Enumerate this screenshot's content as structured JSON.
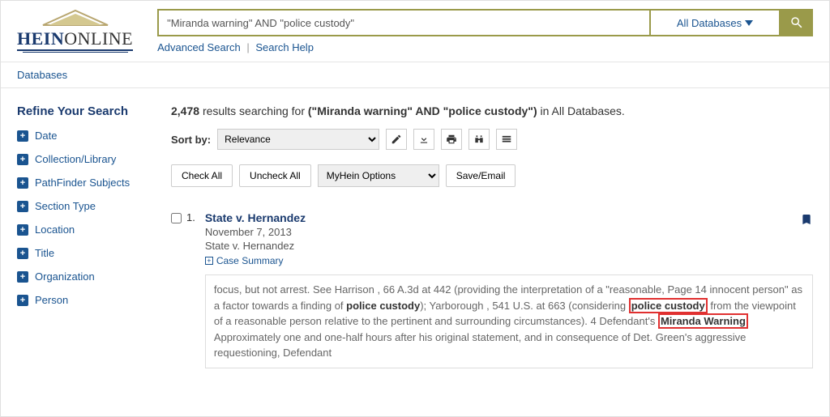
{
  "logo": {
    "brand1": "HEIN",
    "brand2": "ONLINE"
  },
  "search": {
    "query": "\"Miranda warning\" AND \"police custody\"",
    "db_button": "All Databases",
    "advanced": "Advanced Search",
    "help": "Search Help"
  },
  "nav": {
    "databases": "Databases"
  },
  "sidebar": {
    "title": "Refine Your Search",
    "facets": [
      "Date",
      "Collection/Library",
      "PathFinder Subjects",
      "Section Type",
      "Location",
      "Title",
      "Organization",
      "Person"
    ]
  },
  "results": {
    "count": "2,478",
    "prefix": "results searching for",
    "query_display": "(\"Miranda warning\" AND \"police custody\")",
    "suffix": "in All Databases.",
    "sort_label": "Sort by:",
    "sort_value": "Relevance",
    "check_all": "Check All",
    "uncheck_all": "Uncheck All",
    "myhein": "MyHein Options",
    "save_email": "Save/Email"
  },
  "item": {
    "num": "1.",
    "title": "State v. Hernandez",
    "date": "November 7, 2013",
    "sub": "State v. Hernandez",
    "case_summary": "Case Summary",
    "snippet": {
      "p1": "focus, but not arrest. See Harrison , 66 A.3d at 442 (providing the interpretation of a \"reasonable, Page 14 innocent person\" as a factor towards a finding of ",
      "pc1": "police custody",
      "p2": "); Yarborough , 541 U.S. at 663 (considering ",
      "pc2": "police custody",
      "p3": " from the viewpoint of a reasonable person relative to the pertinent and surrounding circumstances). 4 Defendant's ",
      "mw": "Miranda Warning",
      "p4": " Approximately one and one-half hours after his original statement, and in consequence of Det. Green's aggressive requestioning, Defendant"
    }
  }
}
